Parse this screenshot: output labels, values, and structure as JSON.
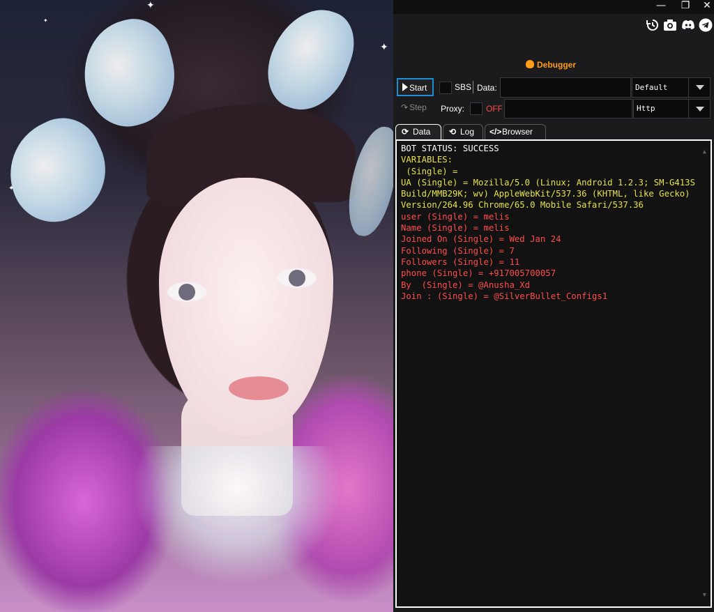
{
  "window": {
    "minimize_glyph": "—",
    "restore_glyph": "❐",
    "close_glyph": "✕"
  },
  "toolbar_icons": [
    "history-icon",
    "camera-icon",
    "discord-icon",
    "telegram-icon"
  ],
  "debugger": {
    "title": "Debugger",
    "start_label": "Start",
    "step_label": "Step",
    "sbs_label": "SBS",
    "data_label": "Data:",
    "data_value": "",
    "data_type": "Default",
    "proxy_label": "Proxy:",
    "proxy_state": "OFF",
    "proxy_value": "",
    "proxy_type": "Http"
  },
  "tabs": [
    {
      "label": "Data",
      "icon": "refresh-icon",
      "active": true
    },
    {
      "label": "Log",
      "icon": "history-icon",
      "active": false
    },
    {
      "label": "Browser",
      "icon": "code-icon",
      "active": false
    }
  ],
  "colors": {
    "status": "#ffffff",
    "variables": "#e7e24a",
    "captures": "#ff4d4d",
    "accent": "#ff9c1a",
    "focus": "#1e8fd6"
  },
  "output": [
    {
      "text": "BOT STATUS: SUCCESS",
      "kind": "status"
    },
    {
      "text": "VARIABLES:",
      "kind": "variables"
    },
    {
      "text": " (Single) =",
      "kind": "variables"
    },
    {
      "text": "UA (Single) = Mozilla/5.0 (Linux; Android 1.2.3; SM-G413S Build/MMB29K; wv) AppleWebKit/537.36 (KHTML, like Gecko) Version/264.96 Chrome/65.0 Mobile Safari/537.36",
      "kind": "variables"
    },
    {
      "text": "user (Single) = melis",
      "kind": "captures"
    },
    {
      "text": "Name (Single) = melis",
      "kind": "captures"
    },
    {
      "text": "Joined On (Single) = Wed Jan 24",
      "kind": "captures"
    },
    {
      "text": "Following (Single) = 7",
      "kind": "captures"
    },
    {
      "text": "Followers (Single) = 11",
      "kind": "captures"
    },
    {
      "text": "phone (Single) = +917005700057",
      "kind": "captures"
    },
    {
      "text": "By  (Single) = @Anusha_Xd",
      "kind": "captures"
    },
    {
      "text": "Join : (Single) = @SilverBullet_Configs1",
      "kind": "captures"
    }
  ]
}
